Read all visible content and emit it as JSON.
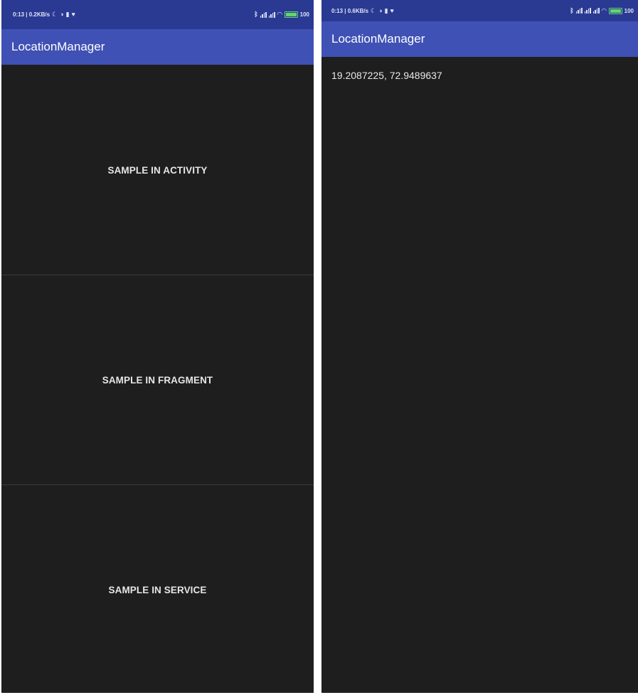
{
  "left_screen": {
    "status_bar": {
      "text": "0:13 | 0.2KB/s",
      "battery": "100"
    },
    "app_bar": {
      "title": "LocationManager"
    },
    "buttons": [
      {
        "label": "SAMPLE IN ACTIVITY"
      },
      {
        "label": "SAMPLE IN FRAGMENT"
      },
      {
        "label": "SAMPLE IN SERVICE"
      }
    ]
  },
  "right_screen": {
    "status_bar": {
      "text": "0:13 | 0.6KB/s",
      "battery": "100"
    },
    "app_bar": {
      "title": "LocationManager"
    },
    "location_text": "19.2087225, 72.9489637"
  },
  "colors": {
    "status_bar": "#2a3a93",
    "app_bar": "#3f51b5",
    "background": "#1e1e1e",
    "text": "#e6e6e6"
  }
}
